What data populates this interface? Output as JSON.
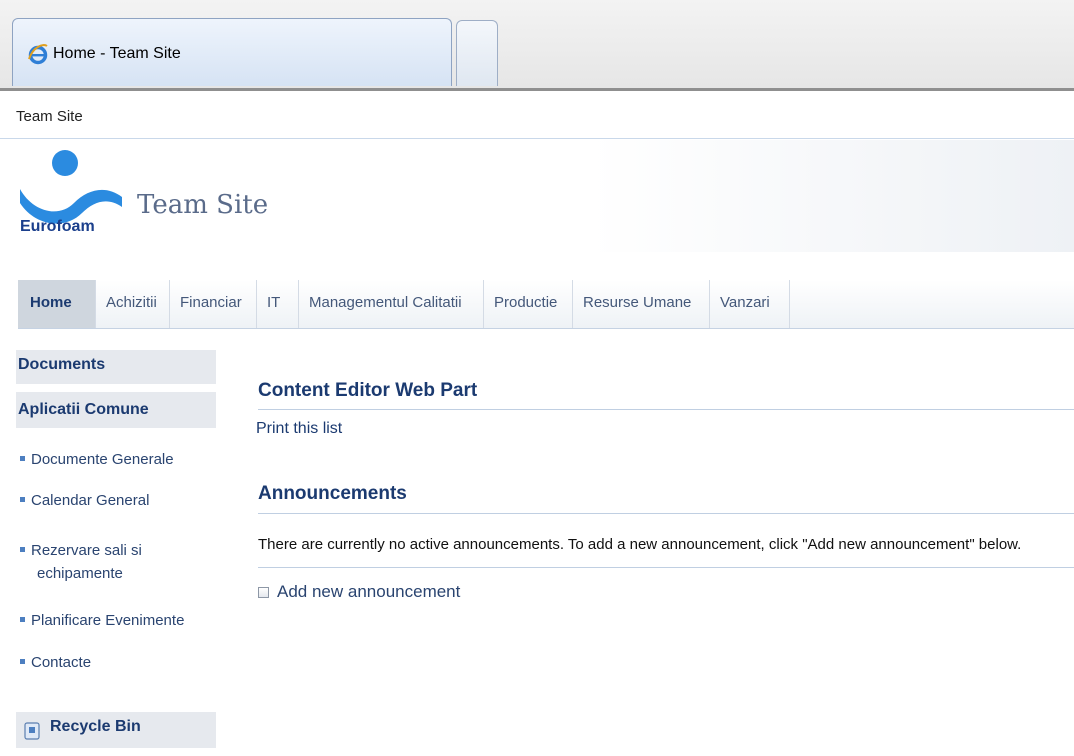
{
  "browser": {
    "tab_title": "Home - Team Site"
  },
  "breadcrumb": "Team Site",
  "header": {
    "logo_text": "Eurofoam",
    "site_title": "Team Site"
  },
  "topnav": {
    "items": [
      {
        "label": "Home",
        "selected": true
      },
      {
        "label": "Achizitii"
      },
      {
        "label": "Financiar"
      },
      {
        "label": "IT"
      },
      {
        "label": "Managementul Calitatii"
      },
      {
        "label": "Productie"
      },
      {
        "label": "Resurse Umane"
      },
      {
        "label": "Vanzari"
      }
    ]
  },
  "quicklaunch": {
    "documents": "Documents",
    "aplicatii": "Aplicatii Comune",
    "items": [
      {
        "line1": "Documente Generale"
      },
      {
        "line1": "Calendar General"
      },
      {
        "line1": "Rezervare sali si",
        "line2": "echipamente"
      },
      {
        "line1": "Planificare Evenimente"
      },
      {
        "line1": "Contacte"
      }
    ],
    "recycle_bin": "Recycle Bin"
  },
  "main": {
    "cewp_title": "Content Editor Web Part",
    "print_link": "Print this list",
    "announcements_title": "Announcements",
    "announcements_empty": "There are currently no active announcements. To add a new announcement, click \"Add new announcement\" below.",
    "add_new": "Add new announcement"
  },
  "colors": {
    "accent": "#1b3a70",
    "nav_selected_bg": "#cfd6de",
    "quicklaunch_bg": "#e6e9ee"
  }
}
